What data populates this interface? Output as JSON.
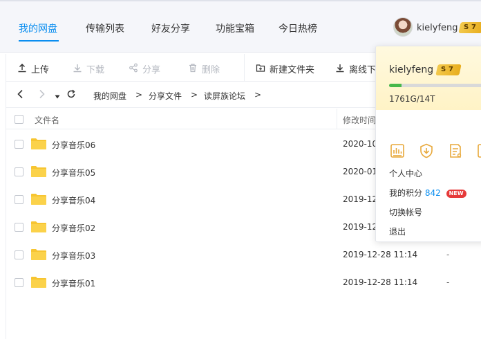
{
  "nav": {
    "tabs": [
      {
        "label": "我的网盘"
      },
      {
        "label": "传输列表"
      },
      {
        "label": "好友分享"
      },
      {
        "label": "功能宝箱"
      },
      {
        "label": "今日热榜"
      }
    ],
    "username": "kielyfeng",
    "vip_level": "7",
    "vip_letter": "S"
  },
  "toolbar": {
    "upload": "上传",
    "download": "下载",
    "share": "分享",
    "delete": "删除",
    "new_folder": "新建文件夹",
    "offline": "离线下"
  },
  "breadcrumb": {
    "items": [
      "我的网盘",
      "分享文件",
      "读屏族论坛"
    ],
    "separator": ">"
  },
  "list": {
    "header_name": "文件名",
    "header_modified": "修改时间",
    "rows": [
      {
        "name": "分享音乐06",
        "date": "2020-10",
        "size": ""
      },
      {
        "name": "分享音乐05",
        "date": "2020-01",
        "size": ""
      },
      {
        "name": "分享音乐04",
        "date": "2019-12",
        "size": ""
      },
      {
        "name": "分享音乐02",
        "date": "2019-12",
        "size": ""
      },
      {
        "name": "分享音乐03",
        "date": "2019-12-28 11:14",
        "size": "-"
      },
      {
        "name": "分享音乐01",
        "date": "2019-12-28 11:14",
        "size": "-"
      }
    ]
  },
  "dropdown": {
    "username": "kielyfeng",
    "vip_level": "7",
    "vip_letter": "S",
    "quota": "1761G/14T",
    "quota_used_fraction": 0.126,
    "icons": [
      "member-card-icon",
      "download-shield-icon",
      "task-list-icon",
      "edit-icon"
    ],
    "personal_center": "个人中心",
    "points_label": "我的积分",
    "points_value": "842",
    "new_badge": "NEW",
    "switch_account": "切换帐号",
    "logout": "退出"
  },
  "colors": {
    "accent": "#0a8ef0",
    "folder": "#f7c531",
    "quota_bar": "#47b84b",
    "gold_icon": "#e8a83a",
    "new_badge": "#e63a3a"
  }
}
